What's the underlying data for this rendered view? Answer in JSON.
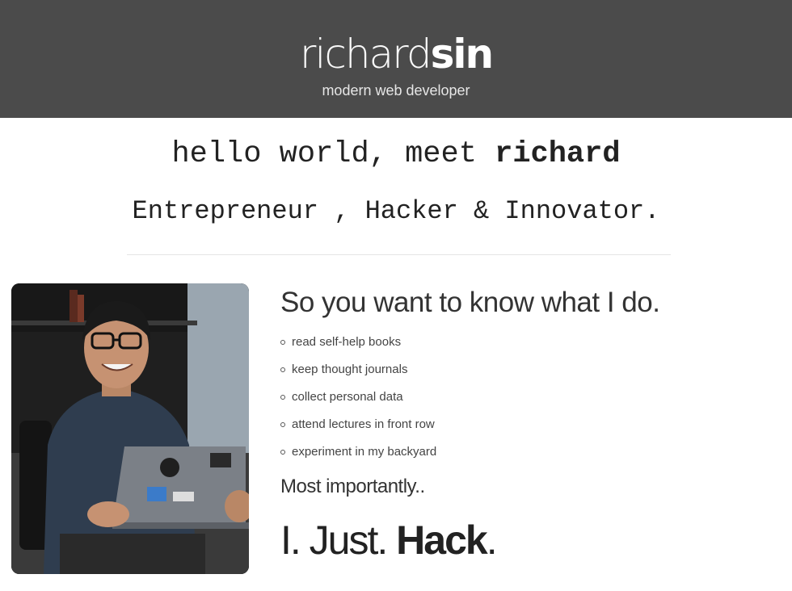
{
  "header": {
    "logo_light": "richard",
    "logo_bold": "sin",
    "tagline": "modern web developer",
    "background": "#4b4b4b"
  },
  "intro": {
    "hello_prefix": "hello world, meet ",
    "hello_name": "richard",
    "roles": "Entrepreneur , Hacker & Innovator."
  },
  "about": {
    "title": "So you want to know what I do.",
    "items": [
      "read self-help books",
      "keep thought journals",
      "collect personal data",
      "attend lectures in front row",
      "experiment in my backyard"
    ],
    "most_importantly": "Most importantly..",
    "hack_prefix": "I. Just. ",
    "hack_word": "Hack",
    "hack_period": "."
  },
  "photo": {
    "alt": "richard-portrait-photo"
  }
}
